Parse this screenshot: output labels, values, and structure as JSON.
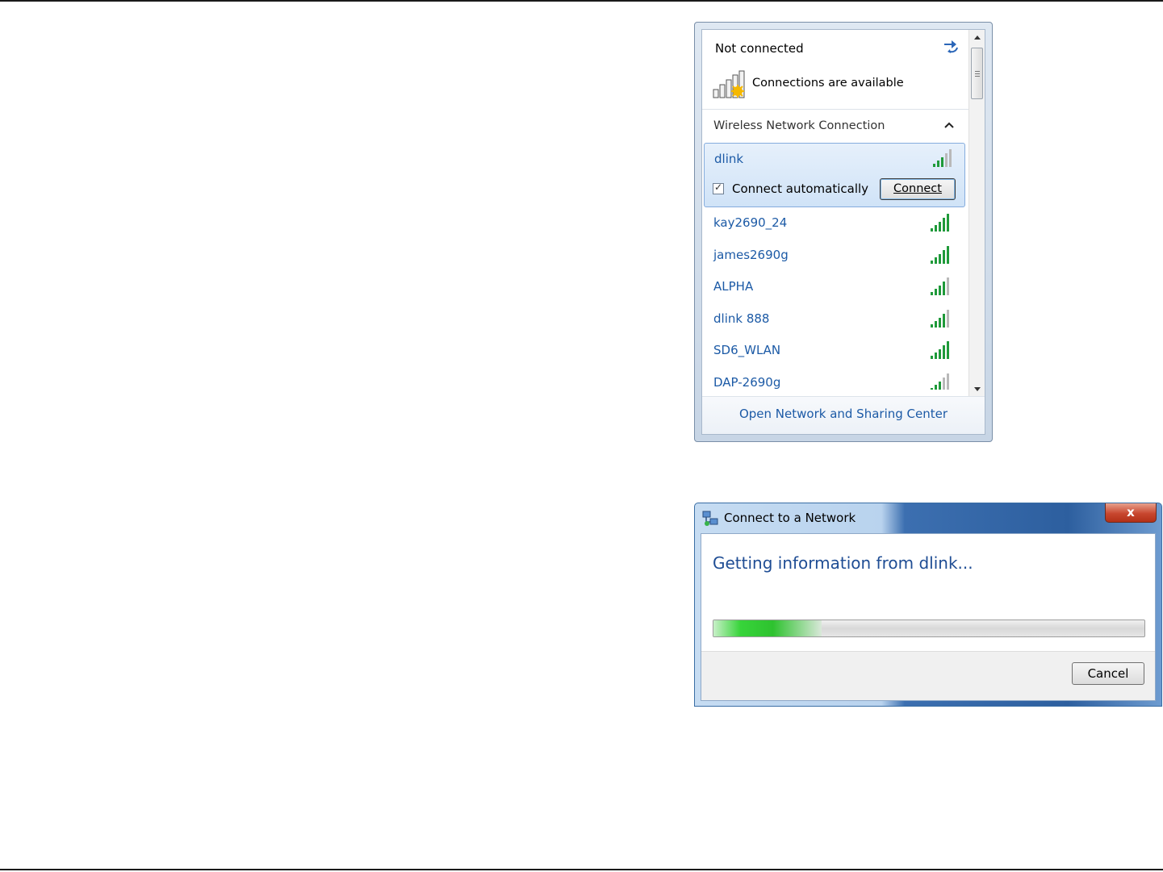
{
  "flyout": {
    "status": "Not connected",
    "availability": "Connections are available",
    "section_label": "Wireless Network Connection",
    "selected_network": {
      "name": "dlink",
      "auto_connect_label": "Connect automatically",
      "auto_connect_checked": true,
      "connect_label": "Connect"
    },
    "networks": [
      {
        "name": "kay2690_24"
      },
      {
        "name": "james2690g"
      },
      {
        "name": "ALPHA"
      },
      {
        "name": "dlink 888"
      },
      {
        "name": "SD6_WLAN"
      },
      {
        "name": "DAP-2690g"
      }
    ],
    "footer_link": "Open Network and Sharing Center",
    "icons": {
      "refresh": "refresh-icon",
      "signal_warning": "signal-warning-icon",
      "collapse": "chevron-up-icon",
      "signal": "signal-strength-icon",
      "scroll_up": "scroll-up-icon",
      "scroll_down": "scroll-down-icon"
    }
  },
  "dialog": {
    "title": "Connect to a Network",
    "close_label": "x",
    "message": "Getting information from dlink...",
    "progress_fraction": 0.25,
    "cancel_label": "Cancel",
    "icons": {
      "app": "network-connect-icon",
      "close": "close-icon"
    }
  },
  "colors": {
    "link": "#1c5aa6",
    "heading": "#1f4d94",
    "signal_green": "#1f9a3a",
    "progress_green": "#37d43a"
  }
}
